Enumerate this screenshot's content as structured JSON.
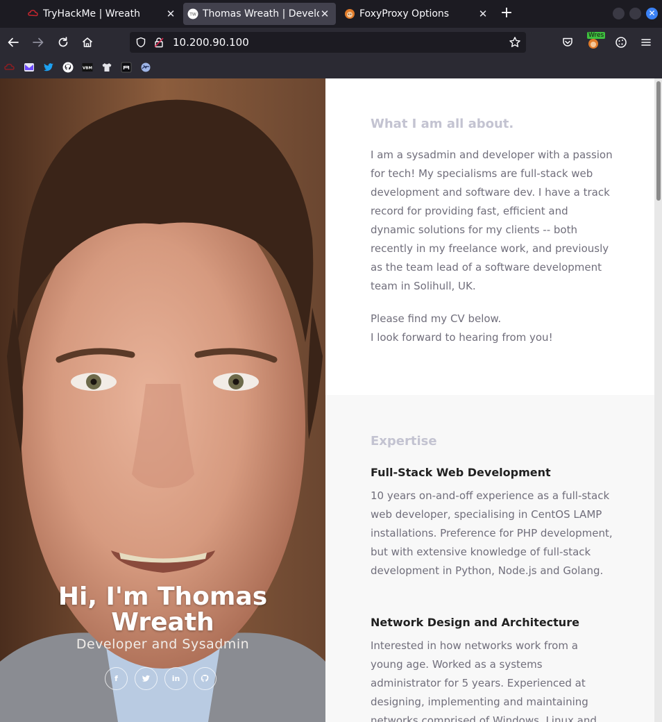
{
  "tabs": [
    {
      "title": "TryHackMe | Wreath",
      "icon": "tryhackme-icon"
    },
    {
      "title": "Thomas Wreath | Develop",
      "icon": "tw-favicon-icon"
    },
    {
      "title": "FoxyProxy Options",
      "icon": "foxyproxy-icon"
    }
  ],
  "url": "10.200.90.100",
  "extension_badge": "Wres",
  "hero": {
    "name_line1": "Hi, I'm Thomas",
    "name_line2": "Wreath",
    "role": "Developer and Sysadmin",
    "socials": [
      "f",
      "t",
      "in",
      "gh"
    ]
  },
  "about": {
    "title": "What I am all about.",
    "p1": "I am a sysadmin and developer with a passion for tech! My specialisms are full-stack web development and software dev. I have a track record for providing fast, efficient and dynamic solutions for my clients -- both recently in my freelance work, and previously as the team lead of a software development team in Solihull, UK.",
    "p2_line1": "Please find my CV below.",
    "p2_line2": "I look forward to hearing from you!"
  },
  "expertise": {
    "title": "Expertise",
    "items": [
      {
        "heading": "Full-Stack Web Development",
        "text": "10 years on-and-off experience as a full-stack web developer, specialising in CentOS LAMP installations. Preference for PHP development, but with extensive knowledge of full-stack development in Python, Node.js and Golang."
      },
      {
        "heading": "Network Design and Architecture",
        "text": "Interested in how networks work from a young age. Worked as a systems administrator for 5 years. Experienced at designing, implementing and maintaining networks comprised of Windows, Linux and"
      }
    ]
  },
  "colors": {
    "accent_blue": "#3b82f6",
    "heading_muted": "#c3c3d1",
    "body_text": "#706e7b"
  }
}
